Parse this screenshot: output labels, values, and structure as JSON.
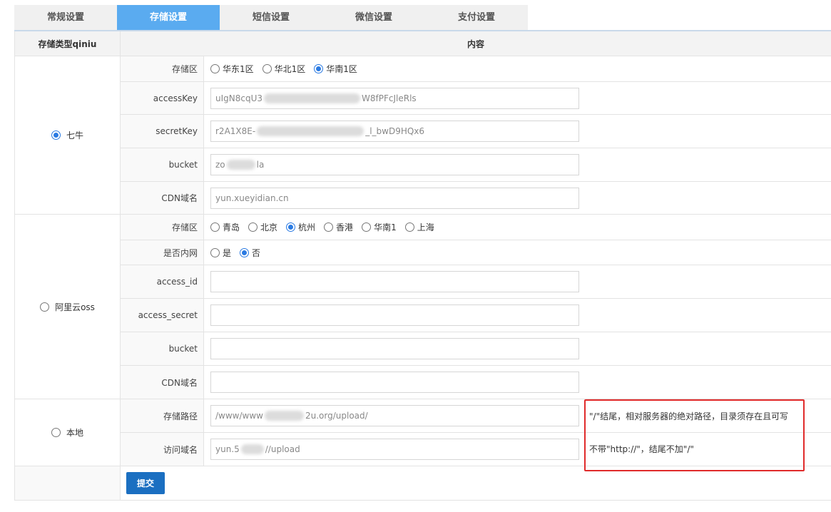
{
  "tabs": [
    "常规设置",
    "存储设置",
    "短信设置",
    "微信设置",
    "支付设置"
  ],
  "header": {
    "col1": "存储类型qiniu",
    "col2": "内容"
  },
  "qiniu": {
    "label": "七牛",
    "region_label": "存储区",
    "regions": [
      "华东1区",
      "华北1区",
      "华南1区"
    ],
    "access_key_label": "accessKey",
    "access_key_start": "uIgN8cqU3",
    "access_key_end": "W8fPFcJleRls",
    "secret_key_label": "secretKey",
    "secret_key_start": "r2A1X8E-",
    "secret_key_end": "_l_bwD9HQx6",
    "bucket_label": "bucket",
    "bucket_start": "zo",
    "bucket_end": "la",
    "cdn_label": "CDN域名",
    "cdn_value": "yun.xueyidian.cn"
  },
  "aliyun": {
    "label": "阿里云oss",
    "region_label": "存储区",
    "regions": [
      "青岛",
      "北京",
      "杭州",
      "香港",
      "华南1",
      "上海"
    ],
    "intranet_label": "是否内网",
    "intranet_options": [
      "是",
      "否"
    ],
    "access_id_label": "access_id",
    "access_secret_label": "access_secret",
    "bucket_label": "bucket",
    "cdn_label": "CDN域名"
  },
  "local": {
    "label": "本地",
    "path_label": "存储路径",
    "path_start": "/www/www",
    "path_end": "2u.org/upload/",
    "domain_label": "访问域名",
    "domain_start": "yun.5",
    "domain_end": "//upload",
    "path_note": "\"/\"结尾，相对服务器的绝对路径，目录须存在且可写",
    "domain_note": "不带\"http://\"，结尾不加\"/\""
  },
  "submit_label": "提交",
  "colors": {
    "tab_active": "#5aabf0",
    "submit": "#1b6fc1",
    "highlight_border": "#e02b2b",
    "radio_on": "#2a7ae2"
  }
}
